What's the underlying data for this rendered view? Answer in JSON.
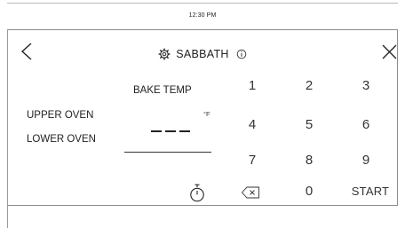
{
  "status_bar": {
    "time": "12:30 PM"
  },
  "header": {
    "title": "SABBATH",
    "icons": {
      "back": "chevron-left-icon",
      "mode": "gear-icon",
      "info": "info-icon",
      "close": "close-icon"
    }
  },
  "temperature": {
    "label": "BAKE TEMP",
    "unit": "°F",
    "placeholder_digits": 3
  },
  "ovens": {
    "upper": "UPPER OVEN",
    "lower": "LOWER OVEN"
  },
  "keypad": {
    "keys": [
      "1",
      "2",
      "3",
      "4",
      "5",
      "6",
      "7",
      "8",
      "9",
      "0"
    ],
    "start": "START",
    "timer_icon": "timer-icon",
    "backspace_icon": "backspace-icon"
  },
  "colors": {
    "text": "#333333",
    "line": "#8c8c8c"
  }
}
